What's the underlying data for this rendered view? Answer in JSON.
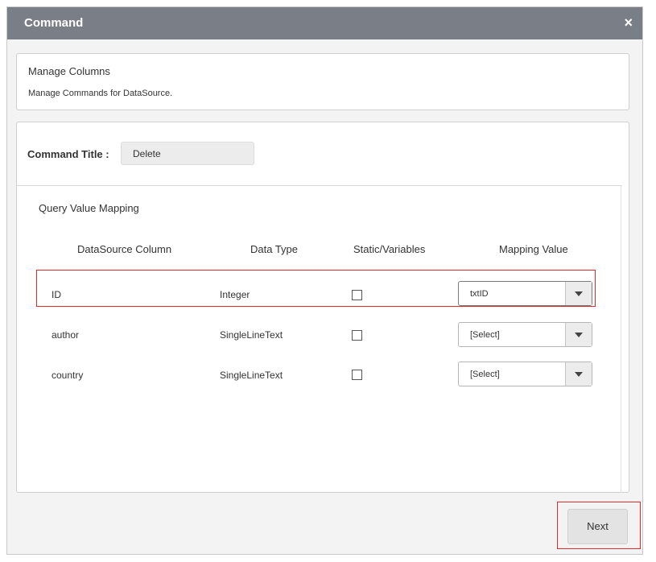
{
  "dialog": {
    "title": "Command",
    "close_glyph": "×",
    "next_label": "Next"
  },
  "manage": {
    "heading": "Manage Columns",
    "subtitle": "Manage Commands for DataSource."
  },
  "command": {
    "label": "Command Title :",
    "value": "Delete"
  },
  "mapping": {
    "section_title": "Query Value Mapping",
    "columns": [
      "DataSource Column",
      "Data Type",
      "Static/Variables",
      "Mapping Value"
    ],
    "rows": [
      {
        "column": "ID",
        "type": "Integer",
        "static": false,
        "mapping": "txtID"
      },
      {
        "column": "author",
        "type": "SingleLineText",
        "static": false,
        "mapping": "[Select]"
      },
      {
        "column": "country",
        "type": "SingleLineText",
        "static": false,
        "mapping": "[Select]"
      }
    ]
  },
  "colors": {
    "titlebar": "#7a7f87",
    "highlight": "#e02a2a",
    "dialog_bg": "#f3f3f3"
  }
}
